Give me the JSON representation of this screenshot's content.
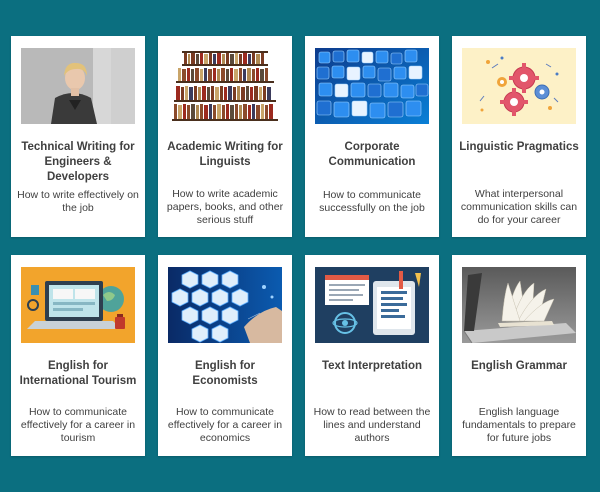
{
  "courses": [
    {
      "title": "Technical Writing for Engineers & Developers",
      "desc": "How to write effectively on the job",
      "image_icon": "woman-portrait-photo"
    },
    {
      "title": "Academic Writing for Linguists",
      "desc": "How to write academic papers, books, and other serious stuff",
      "image_icon": "bookshelf-photo"
    },
    {
      "title": "Corporate Communication",
      "desc": "How to communicate successfully on the job",
      "image_icon": "app-icons-photo"
    },
    {
      "title": "Linguistic Pragmatics",
      "desc": "What interpersonal communication skills can do for your career",
      "image_icon": "gears-illustration"
    },
    {
      "title": "English for International Tourism",
      "desc": "How to communicate effectively for a career in tourism",
      "image_icon": "laptop-travel-illustration"
    },
    {
      "title": "English for Economists",
      "desc": "How to communicate effectively for a career in economics",
      "image_icon": "hexagon-network-illustration"
    },
    {
      "title": "Text Interpretation",
      "desc": "How to read between the lines and understand authors",
      "image_icon": "documents-illustration"
    },
    {
      "title": "English Grammar",
      "desc": "English language fundamentals to prepare for future jobs",
      "image_icon": "laptop-book-photo"
    }
  ],
  "colors": {
    "background": "#0b6f80",
    "card": "#ffffff",
    "text": "#404040"
  }
}
